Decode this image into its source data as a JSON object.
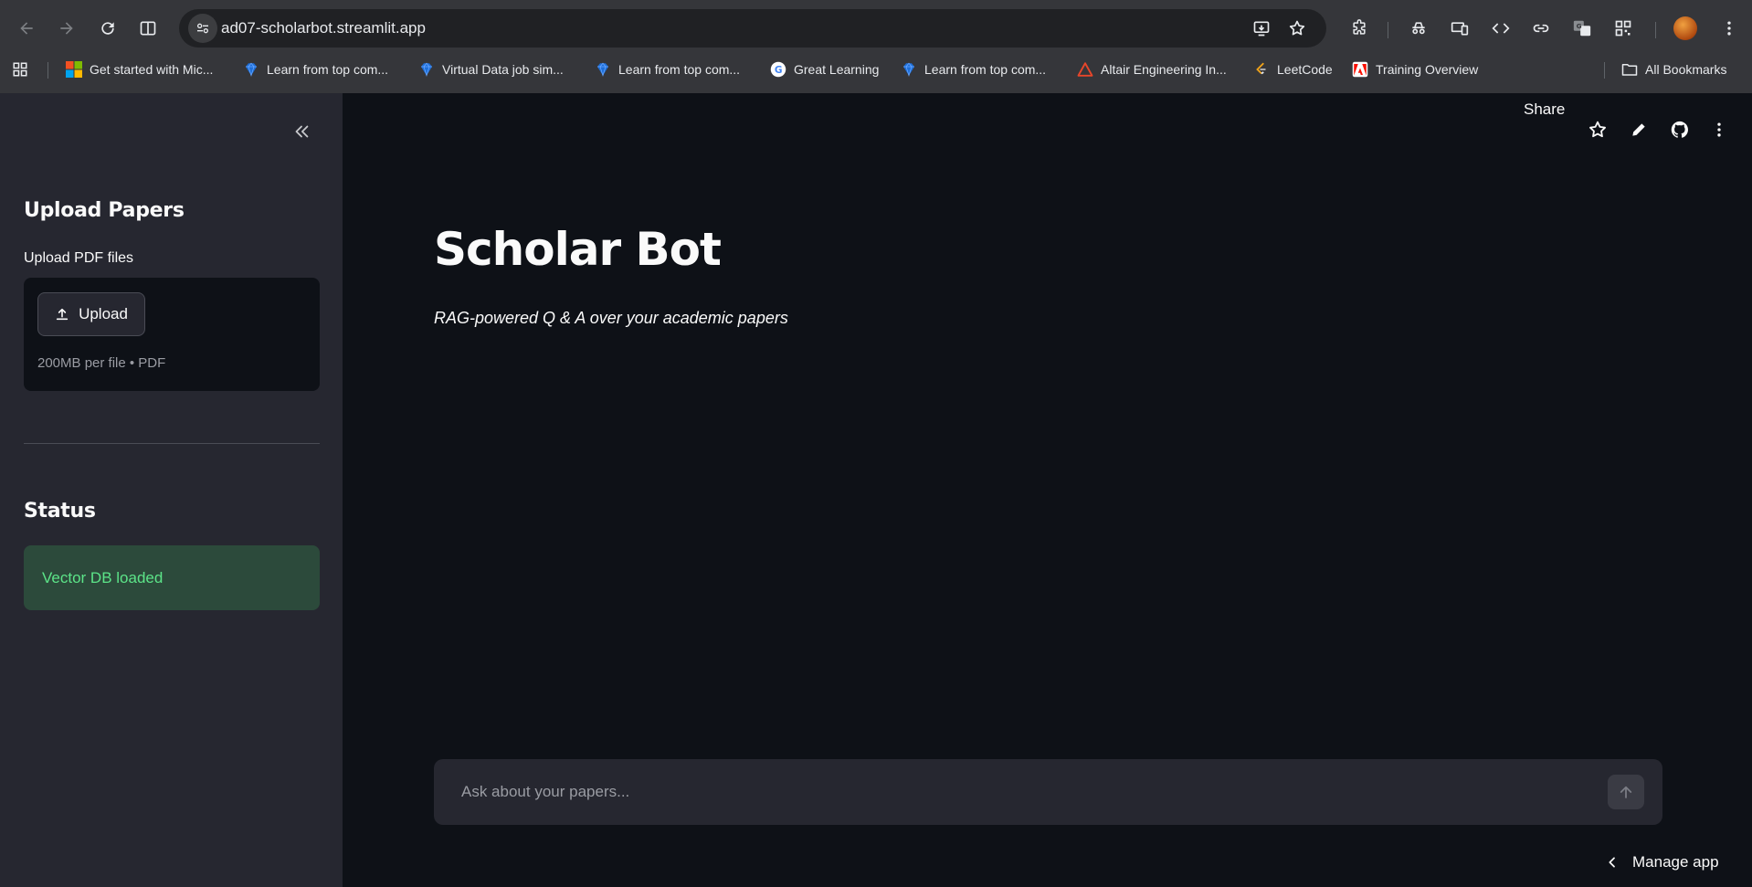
{
  "browser": {
    "url": "ad07-scholarbot.streamlit.app",
    "bookmarks": [
      {
        "label": "Get started with Mic...",
        "icon": "microsoft-logo-icon"
      },
      {
        "label": "Learn from top com...",
        "icon": "diamond-icon"
      },
      {
        "label": "Virtual Data job sim...",
        "icon": "diamond-icon"
      },
      {
        "label": "Learn from top com...",
        "icon": "diamond-icon"
      },
      {
        "label": "Great Learning",
        "icon": "google-g-icon"
      },
      {
        "label": "Learn from top com...",
        "icon": "diamond-icon"
      },
      {
        "label": "Altair Engineering In...",
        "icon": "altair-icon"
      },
      {
        "label": "LeetCode",
        "icon": "leetcode-icon"
      },
      {
        "label": "Training Overview",
        "icon": "adobe-icon"
      }
    ],
    "all_bookmarks_label": "All Bookmarks"
  },
  "sidebar": {
    "upload_heading": "Upload Papers",
    "upload_label": "Upload PDF files",
    "upload_button": "Upload",
    "upload_hint": "200MB per file • PDF",
    "status_heading": "Status",
    "status_message": "Vector DB loaded"
  },
  "header": {
    "share_label": "Share"
  },
  "main": {
    "title": "Scholar Bot",
    "subtitle": "RAG-powered Q & A over your academic papers"
  },
  "chat": {
    "placeholder": "Ask about your papers..."
  },
  "footer": {
    "manage_app_label": "Manage app"
  },
  "colors": {
    "app_bg": "#0e1117",
    "sidebar_bg": "#262730",
    "status_bg": "#2c4a3b",
    "status_text": "#5ce488",
    "browser_chrome": "#35363a"
  }
}
